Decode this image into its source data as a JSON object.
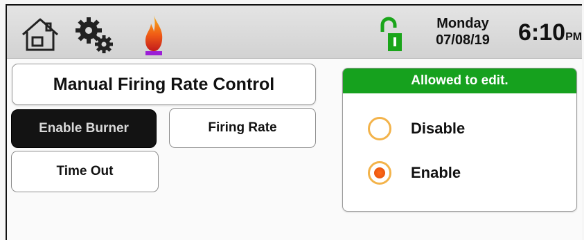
{
  "header": {
    "icons": [
      "home-icon",
      "gear-icon",
      "flame-icon",
      "unlocked-icon"
    ],
    "day": "Monday",
    "date": "07/08/19",
    "time": "6:10",
    "ampm": "PM"
  },
  "main": {
    "title": "Manual Firing Rate Control",
    "buttons": {
      "enable_burner": "Enable Burner",
      "firing_rate": "Firing Rate",
      "time_out": "Time Out"
    }
  },
  "edit_panel": {
    "header": "Allowed to edit.",
    "options": [
      {
        "label": "Disable",
        "selected": false
      },
      {
        "label": "Enable",
        "selected": true
      }
    ]
  },
  "colors": {
    "accent_green": "#16a11e",
    "radio_orange": "#f3b34a",
    "radio_fill": "#e24f08"
  }
}
